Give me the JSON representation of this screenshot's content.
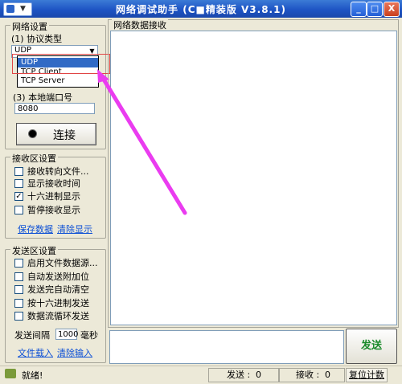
{
  "window": {
    "title": "网络调试助手 (C■精装版 V3.8.1)",
    "sysmenu_arrow": "▼",
    "min": "_",
    "max": "□",
    "close": "X"
  },
  "network": {
    "group_title": "网络设置",
    "protocol_label": "(1) 协议类型",
    "protocol_value": "UDP",
    "protocol_options": [
      "UDP",
      "TCP Client",
      "TCP Server"
    ],
    "port_label": "(3) 本地端口号",
    "port_value": "8080",
    "connect_label": "连接"
  },
  "receive": {
    "group_title": "接收区设置",
    "options": [
      {
        "label": "接收转向文件...",
        "checked": false
      },
      {
        "label": "显示接收时间",
        "checked": false
      },
      {
        "label": "十六进制显示",
        "checked": true
      },
      {
        "label": "暂停接收显示",
        "checked": false
      }
    ],
    "save_link": "保存数据",
    "clear_link": "清除显示"
  },
  "send": {
    "group_title": "发送区设置",
    "options": [
      {
        "label": "启用文件数据源...",
        "checked": false
      },
      {
        "label": "自动发送附加位",
        "checked": false
      },
      {
        "label": "发送完自动清空",
        "checked": false
      },
      {
        "label": "按十六进制发送",
        "checked": false
      },
      {
        "label": "数据流循环发送",
        "checked": false
      }
    ],
    "interval_label": "发送间隔",
    "interval_value": "1000",
    "interval_unit": "毫秒",
    "load_link": "文件载入",
    "clear_link": "清除输入",
    "send_button": "发送"
  },
  "recv_panel": {
    "title": "网络数据接收"
  },
  "status": {
    "ready": "就绪!",
    "sent_label": "发送 :",
    "sent_value": "0",
    "recv_label": "接收 :",
    "recv_value": "0",
    "reset_label": "复位计数"
  },
  "colors": {
    "annotation_arrow": "#ea3cf0",
    "highlight_box": "#e04545",
    "selection": "#316ac5"
  }
}
